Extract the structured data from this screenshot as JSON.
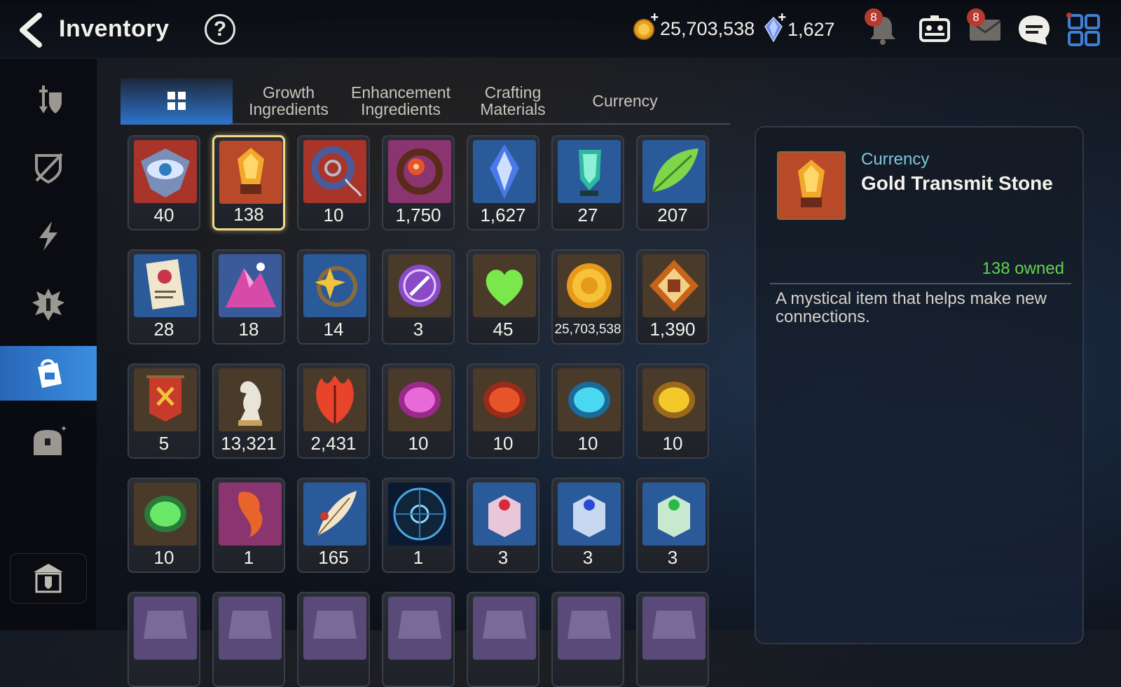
{
  "header": {
    "title": "Inventory",
    "help_label": "?",
    "gold": "25,703,538",
    "crystals": "1,627",
    "notifications_badge": "8",
    "mail_badge": "8"
  },
  "tabs": [
    {
      "label": "",
      "icon": "grid-icon",
      "active": true
    },
    {
      "label": "Growth\nIngredients"
    },
    {
      "label": "Enhancement\nIngredients"
    },
    {
      "label": "Crafting\nMaterials"
    },
    {
      "label": "Currency"
    }
  ],
  "sidebar": [
    "equipment-icon",
    "broken-shield-icon",
    "lightning-icon",
    "spiky-shield-icon",
    "inventory-bag-icon",
    "chest-icon",
    "storage-icon"
  ],
  "items": [
    {
      "name": "eye-emblem",
      "count": "40"
    },
    {
      "name": "gold-transmit-stone",
      "count": "138",
      "selected": true
    },
    {
      "name": "ring-charm",
      "count": "10"
    },
    {
      "name": "red-flower-ring",
      "count": "1,750"
    },
    {
      "name": "blue-crystal",
      "count": "1,627"
    },
    {
      "name": "green-crystal",
      "count": "27"
    },
    {
      "name": "leaf",
      "count": "207"
    },
    {
      "name": "certificate",
      "count": "28"
    },
    {
      "name": "pink-mountain-stone",
      "count": "18"
    },
    {
      "name": "star-ring",
      "count": "14"
    },
    {
      "name": "purple-seal",
      "count": "3"
    },
    {
      "name": "green-heart",
      "count": "45"
    },
    {
      "name": "gold-coin",
      "count": "25,703,538"
    },
    {
      "name": "fist-badge",
      "count": "1,390"
    },
    {
      "name": "banner",
      "count": "5"
    },
    {
      "name": "chess-knight",
      "count": "13,321"
    },
    {
      "name": "red-leaf",
      "count": "2,431"
    },
    {
      "name": "pink-rune",
      "count": "10"
    },
    {
      "name": "red-rune",
      "count": "10"
    },
    {
      "name": "blue-rune",
      "count": "10"
    },
    {
      "name": "yellow-rune",
      "count": "10"
    },
    {
      "name": "green-rune",
      "count": "10"
    },
    {
      "name": "fox-charm",
      "count": "1"
    },
    {
      "name": "feather",
      "count": "165"
    },
    {
      "name": "blue-sigil",
      "count": "1"
    },
    {
      "name": "red-gem-box",
      "count": "3"
    },
    {
      "name": "blue-gem-box",
      "count": "3"
    },
    {
      "name": "green-gem-box",
      "count": "3"
    },
    {
      "name": "partial-1",
      "count": ""
    },
    {
      "name": "partial-2",
      "count": ""
    },
    {
      "name": "partial-3",
      "count": ""
    },
    {
      "name": "partial-4",
      "count": ""
    },
    {
      "name": "partial-5",
      "count": ""
    },
    {
      "name": "partial-6",
      "count": ""
    },
    {
      "name": "partial-7",
      "count": ""
    }
  ],
  "detail": {
    "category": "Currency",
    "name": "Gold Transmit Stone",
    "owned": "138 owned",
    "description": "A mystical item that helps make new connections."
  }
}
